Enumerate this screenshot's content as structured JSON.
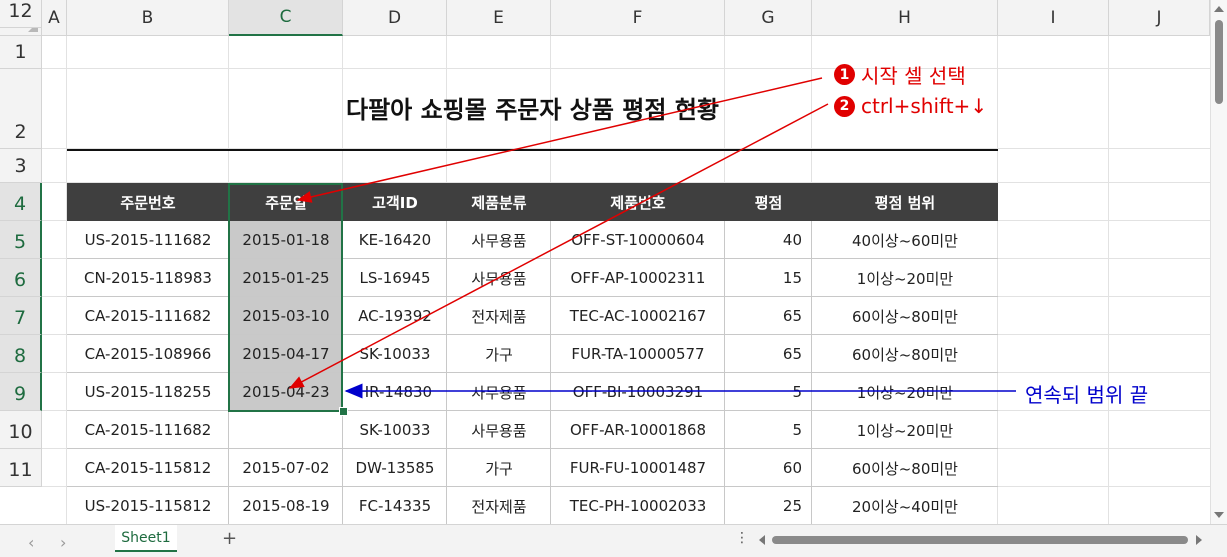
{
  "columns": [
    "A",
    "B",
    "C",
    "D",
    "E",
    "F",
    "G",
    "H",
    "I",
    "J"
  ],
  "rows": [
    "1",
    "2",
    "3",
    "4",
    "5",
    "6",
    "7",
    "8",
    "9",
    "10",
    "11",
    "12"
  ],
  "title": "다팔아 쇼핑몰 주문자 상품 평점 현황",
  "table": {
    "headers": [
      "주문번호",
      "주문일",
      "고객ID",
      "제품분류",
      "제품번호",
      "평점",
      "평점 범위"
    ],
    "rows": [
      [
        "US-2015-111682",
        "2015-01-18",
        "KE-16420",
        "사무용품",
        "OFF-ST-10000604",
        "40",
        "40이상~60미만"
      ],
      [
        "CN-2015-118983",
        "2015-01-25",
        "LS-16945",
        "사무용품",
        "OFF-AP-10002311",
        "15",
        "1이상~20미만"
      ],
      [
        "CA-2015-111682",
        "2015-03-10",
        "AC-19392",
        "전자제품",
        "TEC-AC-10002167",
        "65",
        "60이상~80미만"
      ],
      [
        "CA-2015-108966",
        "2015-04-17",
        "SK-10033",
        "가구",
        "FUR-TA-10000577",
        "65",
        "60이상~80미만"
      ],
      [
        "US-2015-118255",
        "2015-04-23",
        "HR-14830",
        "사무용품",
        "OFF-BI-10003291",
        "5",
        "1이상~20미만"
      ],
      [
        "CA-2015-111682",
        "",
        "SK-10033",
        "사무용품",
        "OFF-AR-10001868",
        "5",
        "1이상~20미만"
      ],
      [
        "CA-2015-115812",
        "2015-07-02",
        "DW-13585",
        "가구",
        "FUR-FU-10001487",
        "60",
        "60이상~80미만"
      ],
      [
        "US-2015-115812",
        "2015-08-19",
        "FC-14335",
        "전자제품",
        "TEC-PH-10002033",
        "25",
        "20이상~40미만"
      ]
    ]
  },
  "annotations": {
    "step1_num": "1",
    "step1_text": "시작 셀 선택",
    "step2_num": "2",
    "step2_text": "ctrl+shift+↓",
    "range_end_text": "연속되 범위 끝",
    "red_color": "#e00000",
    "blue_color": "#0000cc"
  },
  "sheet_tabs": [
    "Sheet1"
  ],
  "add_sheet_label": "+",
  "more_label": "⋮",
  "accent_color": "#217346"
}
